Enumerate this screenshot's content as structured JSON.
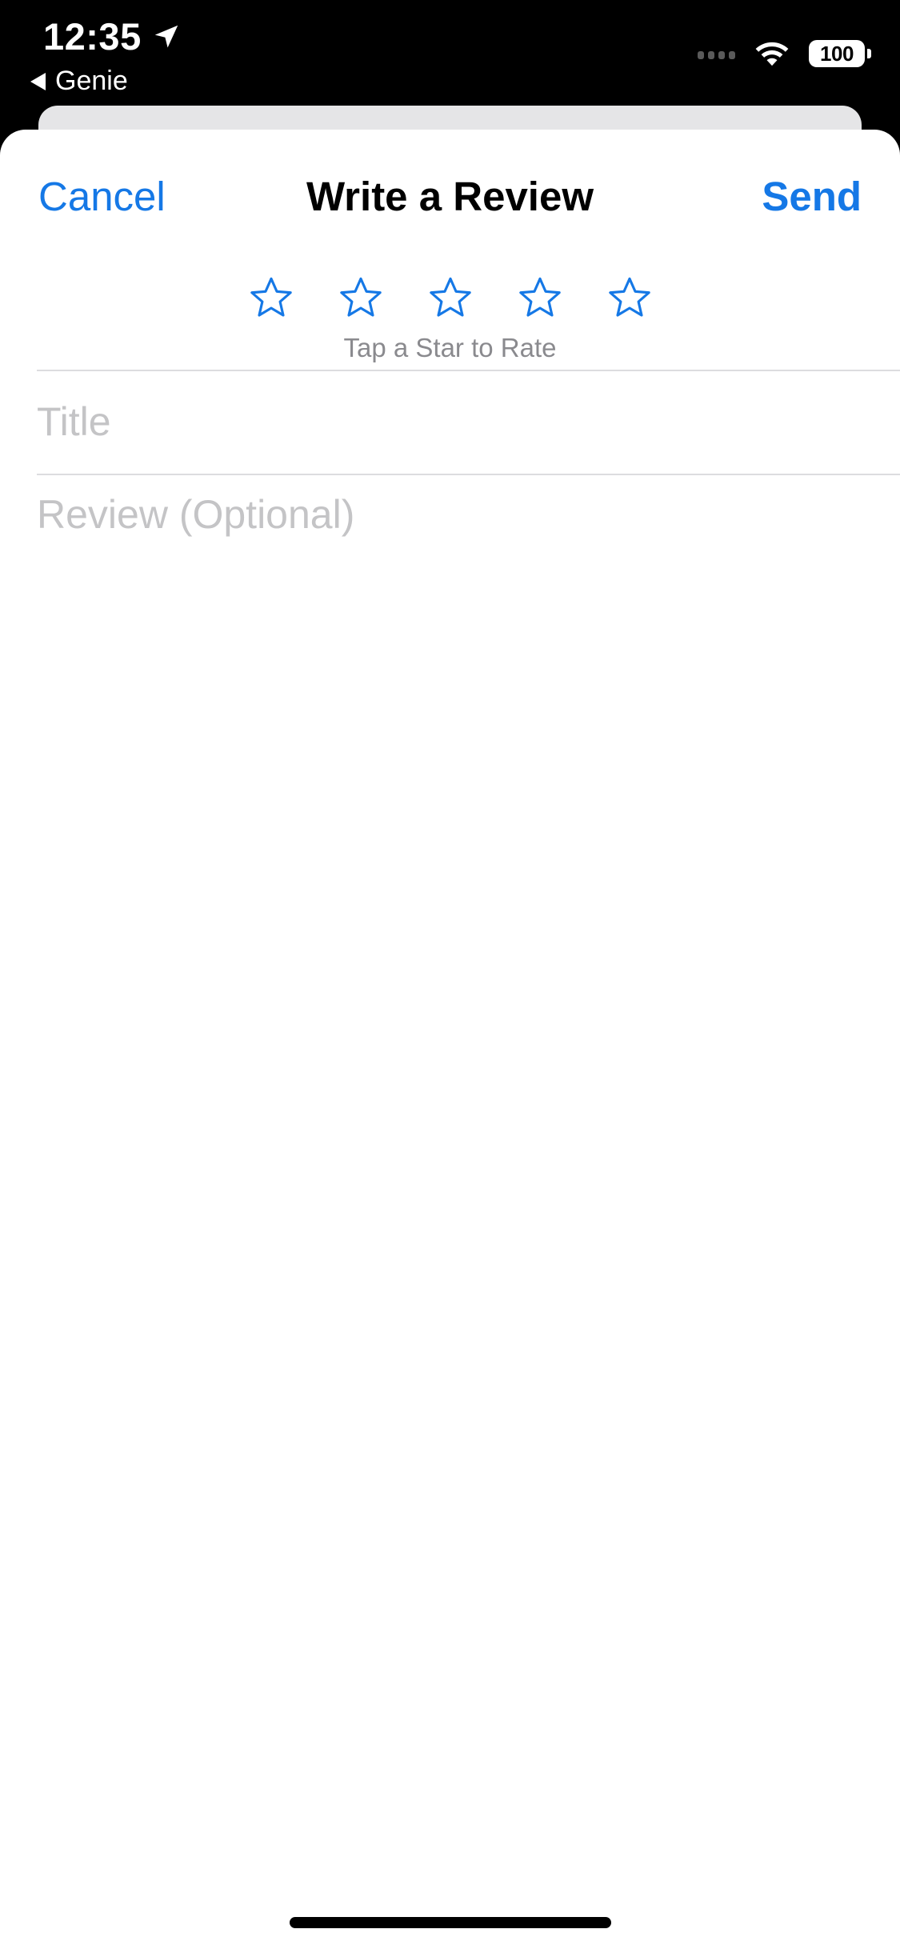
{
  "status_bar": {
    "time": "12:35",
    "back_app": "Genie",
    "battery": "100"
  },
  "nav": {
    "cancel_label": "Cancel",
    "title": "Write a Review",
    "send_label": "Send"
  },
  "rating": {
    "hint": "Tap a Star to Rate",
    "stars": 5,
    "selected": 0
  },
  "form": {
    "title_placeholder": "Title",
    "review_placeholder": "Review (Optional)"
  },
  "colors": {
    "accent": "#1578e6",
    "placeholder": "#c4c4c6",
    "hint": "#8a8a8e"
  }
}
